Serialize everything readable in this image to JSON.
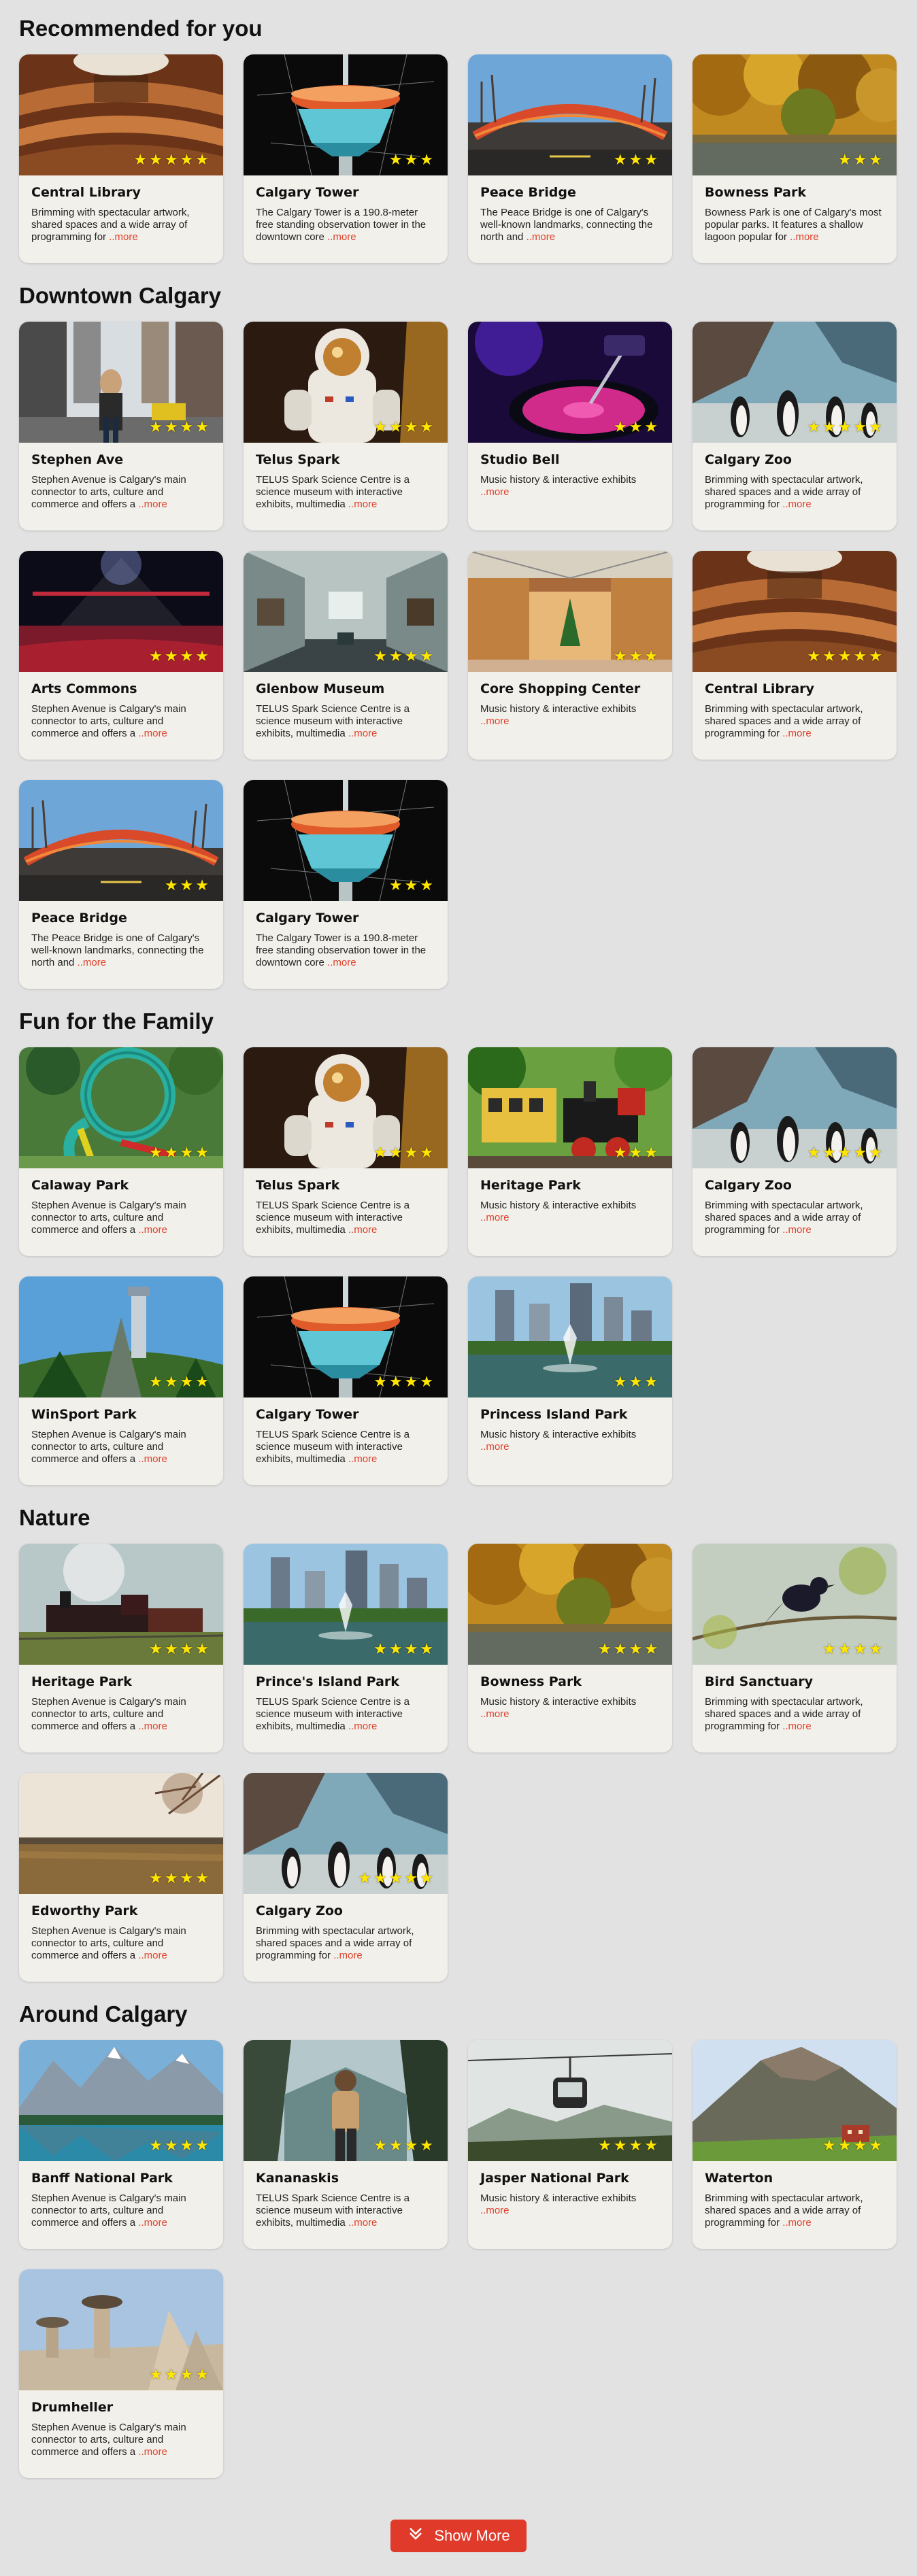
{
  "accent_color": "#e03a2b",
  "star_color": "#ffe600",
  "more_label": "..more",
  "sections": [
    {
      "title": "Recommended for you",
      "cards": [
        {
          "name": "Central Library",
          "desc": "Brimming with spectacular artwork, shared spaces and a wide array of programming for",
          "rating": 5,
          "stars": "★★★★★",
          "image": "library-interior"
        },
        {
          "name": "Calgary Tower",
          "desc": "The Calgary Tower is a 190.8-meter free standing observation tower in the downtown core",
          "rating": 3,
          "stars": "★★★",
          "image": "tower-top"
        },
        {
          "name": "Peace Bridge",
          "desc": "The Peace Bridge is one of Calgary's well-known landmarks, connecting the north and",
          "rating": 3,
          "stars": "★★★",
          "image": "bridge"
        },
        {
          "name": "Bowness Park",
          "desc": "Bowness Park is one of Calgary's most popular parks. It features a shallow lagoon popular for",
          "rating": 3,
          "stars": "★★★",
          "image": "autumn-park"
        }
      ]
    },
    {
      "title": "Downtown Calgary",
      "cards": [
        {
          "name": "Stephen Ave",
          "desc": "Stephen Avenue is Calgary's main connector to arts, culture and commerce and offers a",
          "rating": 4,
          "stars": "★★★★",
          "image": "street"
        },
        {
          "name": "Telus Spark",
          "desc": "TELUS Spark Science Centre is a science museum with interactive exhibits, multimedia",
          "rating": 4,
          "stars": "★★★★",
          "image": "astronaut"
        },
        {
          "name": "Studio Bell",
          "desc": "Music history & interactive exhibits",
          "rating": 3,
          "stars": "★★★",
          "image": "turntable"
        },
        {
          "name": "Calgary Zoo",
          "desc": "Brimming with spectacular artwork, shared spaces and a wide array of programming for",
          "rating": 5,
          "stars": "★★★★★",
          "image": "penguins"
        },
        {
          "name": "Arts Commons",
          "desc": "Stephen Avenue is Calgary's main connector to arts, culture and commerce and offers a",
          "rating": 4,
          "stars": "★★★★",
          "image": "theatre"
        },
        {
          "name": "Glenbow Museum",
          "desc": "TELUS Spark Science Centre is a science museum with interactive exhibits, multimedia",
          "rating": 4,
          "stars": "★★★★",
          "image": "gallery"
        },
        {
          "name": "Core Shopping Center",
          "desc": "Music history & interactive exhibits",
          "rating": 3,
          "stars": "★★★",
          "image": "mall"
        },
        {
          "name": "Central Library",
          "desc": "Brimming with spectacular artwork, shared spaces and a wide array of programming for",
          "rating": 5,
          "stars": "★★★★★",
          "image": "library-interior"
        },
        {
          "name": "Peace Bridge",
          "desc": "The Peace Bridge is one of Calgary's well-known landmarks, connecting the north and",
          "rating": 3,
          "stars": "★★★",
          "image": "bridge"
        },
        {
          "name": "Calgary Tower",
          "desc": "The Calgary Tower is a 190.8-meter free standing observation tower in the downtown core",
          "rating": 3,
          "stars": "★★★",
          "image": "tower-top"
        }
      ]
    },
    {
      "title": "Fun for the Family",
      "cards": [
        {
          "name": "Calaway Park",
          "desc": "Stephen Avenue is Calgary's main connector to arts, culture and commerce and offers a",
          "rating": 4,
          "stars": "★★★★",
          "image": "rollercoaster"
        },
        {
          "name": "Telus Spark",
          "desc": "TELUS Spark Science Centre is a science museum with interactive exhibits, multimedia",
          "rating": 4,
          "stars": "★★★★",
          "image": "astronaut"
        },
        {
          "name": "Heritage Park",
          "desc": "Music history & interactive exhibits",
          "rating": 3,
          "stars": "★★★",
          "image": "steam-train"
        },
        {
          "name": "Calgary Zoo",
          "desc": "Brimming with spectacular artwork, shared spaces and a wide array of programming for",
          "rating": 5,
          "stars": "★★★★★",
          "image": "penguins"
        },
        {
          "name": "WinSport Park",
          "desc": "Stephen Avenue is Calgary's main connector to arts, culture and commerce and offers a",
          "rating": 4,
          "stars": "★★★★",
          "image": "ski-jump"
        },
        {
          "name": "Calgary Tower",
          "desc": "TELUS Spark Science Centre is a science museum with interactive exhibits, multimedia",
          "rating": 4,
          "stars": "★★★★",
          "image": "tower-top"
        },
        {
          "name": "Princess Island Park",
          "desc": "Music history & interactive exhibits",
          "rating": 3,
          "stars": "★★★",
          "image": "city-fountain"
        }
      ]
    },
    {
      "title": "Nature",
      "cards": [
        {
          "name": "Heritage Park",
          "desc": "Stephen Avenue is Calgary's main connector to arts, culture and commerce and offers a",
          "rating": 4,
          "stars": "★★★★",
          "image": "steam-train-field"
        },
        {
          "name": "Prince's Island Park",
          "desc": "TELUS Spark Science Centre is a science museum with interactive exhibits, multimedia",
          "rating": 4,
          "stars": "★★★★",
          "image": "city-fountain"
        },
        {
          "name": "Bowness Park",
          "desc": "Music history & interactive exhibits",
          "rating": 4,
          "stars": "★★★★",
          "image": "autumn-park"
        },
        {
          "name": "Bird Sanctuary",
          "desc": "Brimming with spectacular artwork, shared spaces and a wide array of programming for",
          "rating": 4,
          "stars": "★★★★",
          "image": "bird"
        },
        {
          "name": "Edworthy Park",
          "desc": "Stephen Avenue is Calgary's main connector to arts, culture and commerce and offers a",
          "rating": 4,
          "stars": "★★★★",
          "image": "meadow"
        },
        {
          "name": "Calgary Zoo",
          "desc": "Brimming with spectacular artwork, shared spaces and a wide array of programming for",
          "rating": 5,
          "stars": "★★★★★",
          "image": "penguins"
        }
      ]
    },
    {
      "title": "Around Calgary",
      "cards": [
        {
          "name": "Banff National Park",
          "desc": "Stephen Avenue is Calgary's main connector to arts, culture and commerce and offers a",
          "rating": 4,
          "stars": "★★★★",
          "image": "mountain-lake"
        },
        {
          "name": "Kananaskis",
          "desc": "TELUS Spark Science Centre is a science museum with interactive exhibits, multimedia",
          "rating": 4,
          "stars": "★★★★",
          "image": "hiker"
        },
        {
          "name": "Jasper National Park",
          "desc": "Music history & interactive exhibits",
          "rating": 4,
          "stars": "★★★★",
          "image": "gondola"
        },
        {
          "name": "Waterton",
          "desc": "Brimming with spectacular artwork, shared spaces and a wide array of programming for",
          "rating": 4,
          "stars": "★★★★",
          "image": "mountain-hotel"
        },
        {
          "name": "Drumheller",
          "desc": "Stephen Avenue is Calgary's main connector to arts, culture and commerce and offers a",
          "rating": 4,
          "stars": "★★★★",
          "image": "hoodoos"
        }
      ]
    }
  ],
  "show_more": {
    "label": "Show More",
    "icon": "double-chevron-down-icon"
  }
}
